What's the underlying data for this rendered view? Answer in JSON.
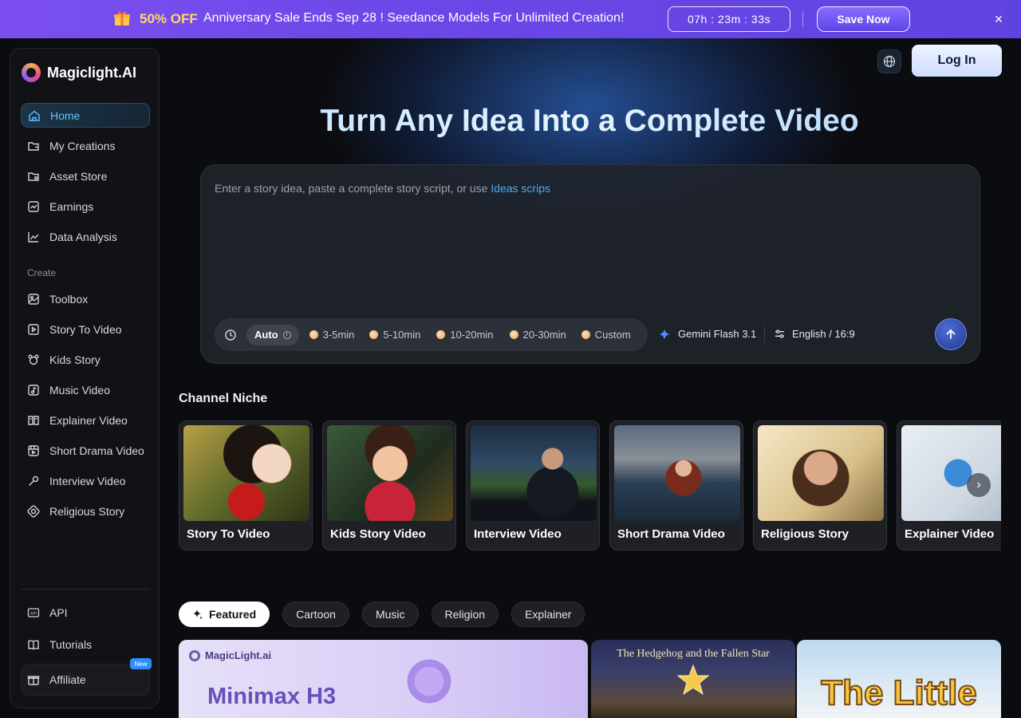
{
  "promo": {
    "discount": "50% OFF",
    "message": "Anniversary Sale Ends Sep 28 ! Seedance Models For Unlimited Creation!",
    "timer": "07h : 23m : 33s",
    "cta": "Save Now",
    "close": "×"
  },
  "brand": {
    "name": "Magiclight.AI"
  },
  "sidebar": {
    "items": [
      {
        "label": "Home"
      },
      {
        "label": "My Creations"
      },
      {
        "label": "Asset Store"
      },
      {
        "label": "Earnings"
      },
      {
        "label": "Data Analysis"
      }
    ],
    "section_label": "Create",
    "create_items": [
      {
        "label": "Toolbox"
      },
      {
        "label": "Story To Video"
      },
      {
        "label": "Kids Story"
      },
      {
        "label": "Music Video"
      },
      {
        "label": "Explainer Video"
      },
      {
        "label": "Short Drama Video"
      },
      {
        "label": "Interview Video"
      },
      {
        "label": "Religious Story"
      }
    ],
    "bottom_items": [
      {
        "label": "API"
      },
      {
        "label": "Tutorials"
      },
      {
        "label": "Affiliate",
        "badge": "New"
      }
    ]
  },
  "header": {
    "login": "Log In"
  },
  "hero": {
    "title": "Turn Any Idea Into a Complete Video"
  },
  "prompt": {
    "placeholder": "Enter a story idea, paste a complete story script, or use ",
    "link": "Ideas scrips",
    "auto": "Auto",
    "durations": [
      "3-5min",
      "5-10min",
      "10-20min",
      "20-30min",
      "Custom"
    ],
    "model": "Gemini Flash 3.1",
    "language": "English / 16:9"
  },
  "niche": {
    "title": "Channel Niche",
    "cards": [
      {
        "label": "Story To Video"
      },
      {
        "label": "Kids Story Video"
      },
      {
        "label": "Interview Video"
      },
      {
        "label": "Short Drama Video"
      },
      {
        "label": "Religious Story"
      },
      {
        "label": "Explainer Video"
      }
    ],
    "next": "›"
  },
  "tabs": [
    "Featured",
    "Cartoon",
    "Music",
    "Religion",
    "Explainer"
  ],
  "featured": {
    "logo": "MagicLight.ai",
    "title": "Minimax H3",
    "hedgehog": "The Hedgehog and the Fallen Star",
    "little": "The Little"
  },
  "colors": {
    "accent": "#49aef7",
    "promo": "#7b4ff0",
    "active_nav": "#5ec3ff"
  }
}
